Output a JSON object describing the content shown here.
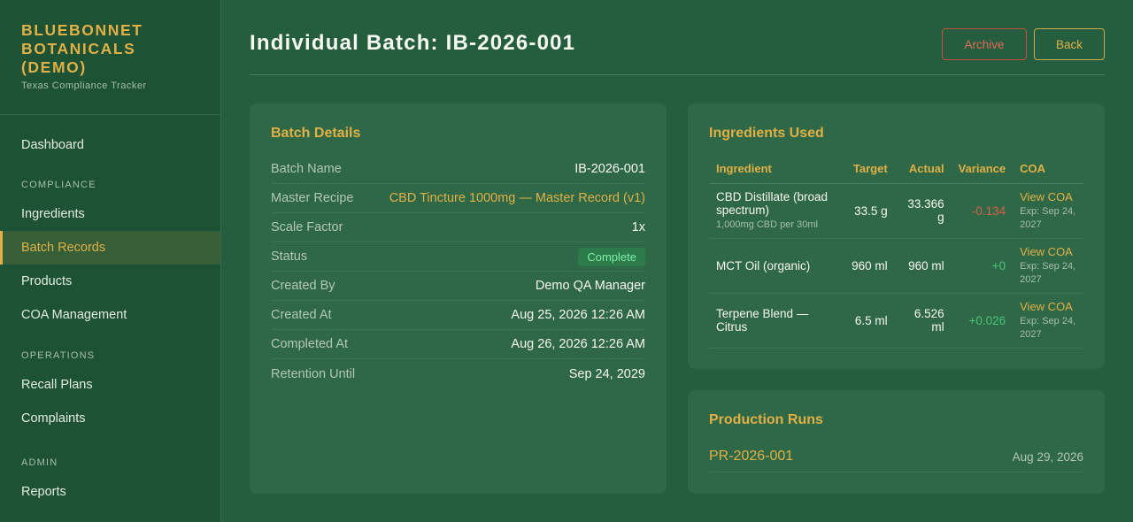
{
  "brand": {
    "title": "BLUEBONNET BOTANICALS (DEMO)",
    "subtitle": "Texas Compliance Tracker"
  },
  "nav": {
    "dashboard": "Dashboard",
    "compliance_header": "COMPLIANCE",
    "ingredients": "Ingredients",
    "batch_records": "Batch Records",
    "products": "Products",
    "coa_management": "COA Management",
    "operations_header": "OPERATIONS",
    "recall_plans": "Recall Plans",
    "complaints": "Complaints",
    "admin_header": "ADMIN",
    "reports": "Reports",
    "active_item": "Batch Records"
  },
  "header": {
    "title": "Individual Batch: IB-2026-001",
    "archive_label": "Archive",
    "back_label": "Back"
  },
  "details": {
    "title": "Batch Details",
    "rows": [
      {
        "label": "Batch Name",
        "value": "IB-2026-001"
      },
      {
        "label": "Master Recipe",
        "value": "CBD Tincture 1000mg — Master Record (v1)"
      },
      {
        "label": "Scale Factor",
        "value": "1x"
      },
      {
        "label": "Status",
        "value": "Complete"
      },
      {
        "label": "Created By",
        "value": "Demo QA Manager"
      },
      {
        "label": "Created At",
        "value": "Aug 25, 2026 12:26 AM"
      },
      {
        "label": "Completed At",
        "value": "Aug 26, 2026 12:26 AM"
      },
      {
        "label": "Retention Until",
        "value": "Sep 24, 2029"
      }
    ]
  },
  "ingredients": {
    "title": "Ingredients Used",
    "columns": [
      "Ingredient",
      "Target",
      "Actual",
      "Variance",
      "COA"
    ],
    "rows": [
      {
        "name": "CBD Distillate (broad spectrum)",
        "sub": "1,000mg CBD per 30ml",
        "target": "33.5 g",
        "actual": "33.366 g",
        "variance": "-0.134",
        "coa_link": "View COA",
        "coa_exp": "Exp: Sep 24, 2027"
      },
      {
        "name": "MCT Oil (organic)",
        "sub": "",
        "target": "960 ml",
        "actual": "960 ml",
        "variance": "+0",
        "coa_link": "View COA",
        "coa_exp": "Exp: Sep 24, 2027"
      },
      {
        "name": "Terpene Blend — Citrus",
        "sub": "",
        "target": "6.5 ml",
        "actual": "6.526 ml",
        "variance": "+0.026",
        "coa_link": "View COA",
        "coa_exp": "Exp: Sep 24, 2027"
      }
    ]
  },
  "runs": {
    "title": "Production Runs",
    "items": [
      {
        "id": "PR-2026-001",
        "date": "Aug 29, 2026"
      }
    ]
  },
  "colors": {
    "accent": "#e0b047",
    "background": "#245e3f",
    "sidebar": "#1d5234",
    "card": "#2f6847",
    "danger": "#e46a55",
    "success": "#4ac37a"
  }
}
